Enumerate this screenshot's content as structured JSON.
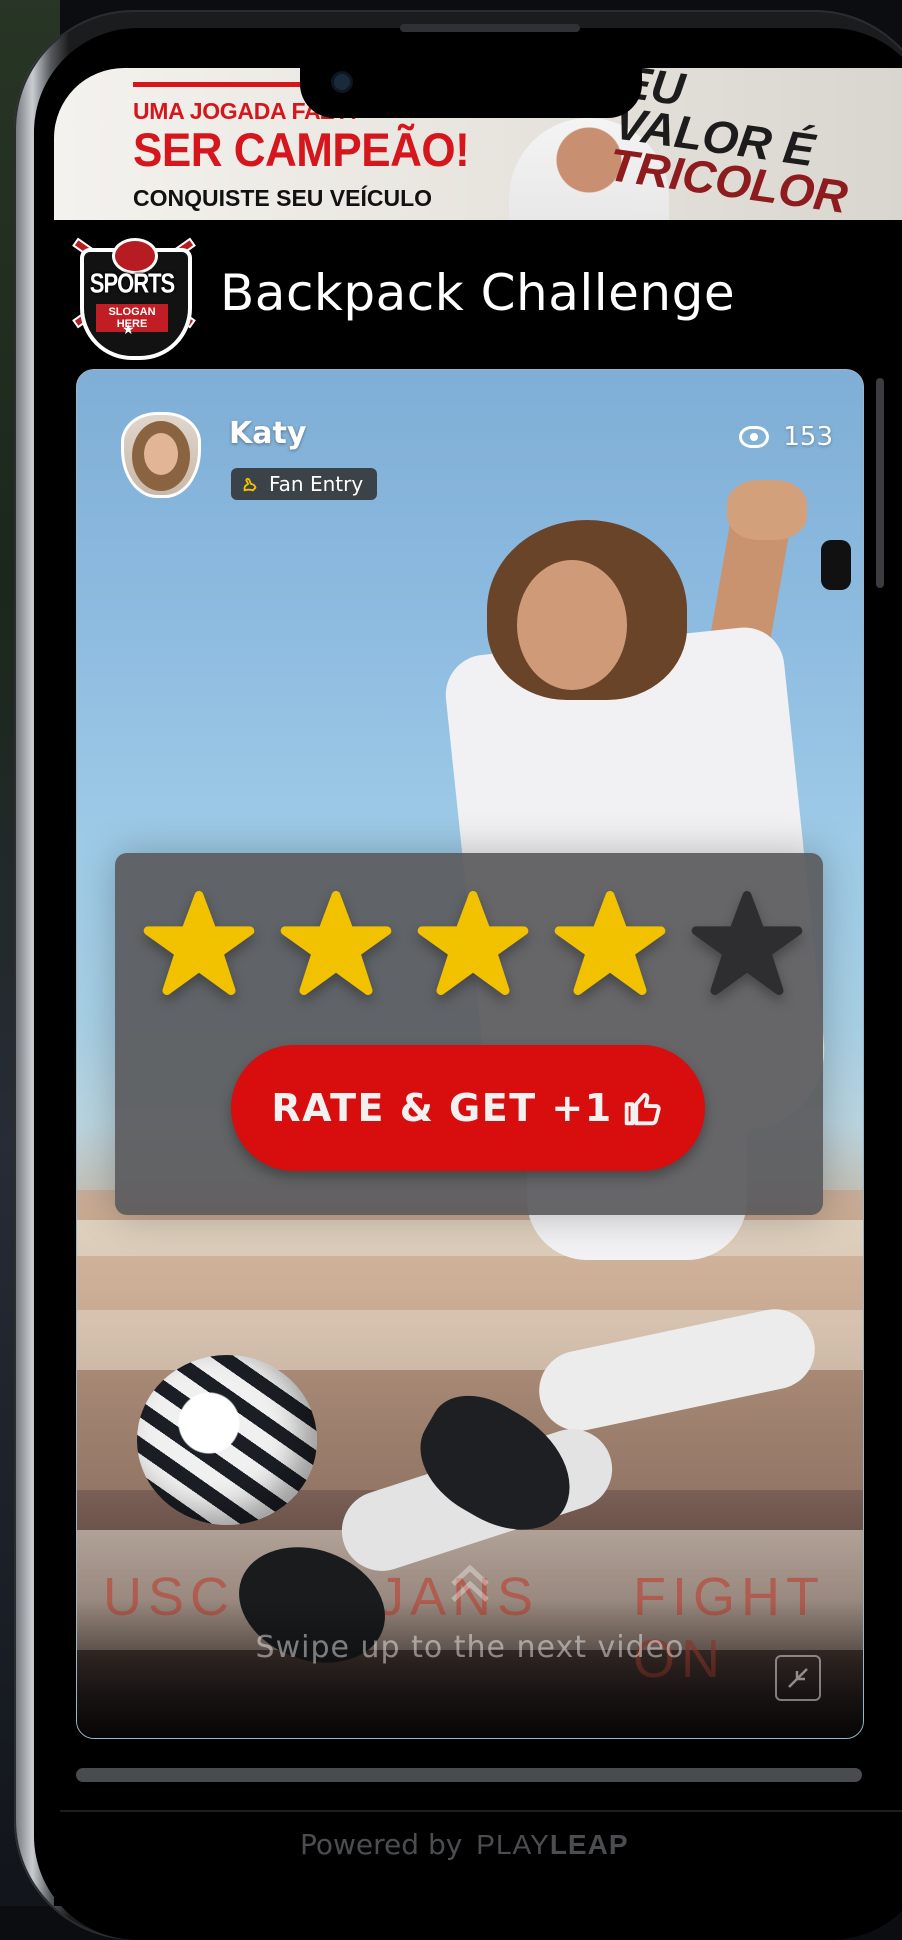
{
  "banner": {
    "line1": "UMA JOGADA FAZ A",
    "line2": "SER CAMPEÃO!",
    "line3": "CONQUISTE SEU VEÍCULO",
    "slogan_a": "EU",
    "slogan_b": "VALOR É",
    "slogan_c": "TRICOLOR"
  },
  "header": {
    "logo_text": "SPORTS LOGO",
    "logo_slogan": "SLOGAN HERE",
    "title": "Backpack Challenge"
  },
  "entry": {
    "user_name": "Katy",
    "badge_label": "Fan Entry",
    "views": "153"
  },
  "background_text": {
    "left": "USC",
    "middle": "JANS",
    "right": "FIGHT ON"
  },
  "rating": {
    "value": 4,
    "max": 5,
    "button_label": "RATE & GET +1",
    "star_color": "#f2c200",
    "empty_star_color": "#2e2e30"
  },
  "swipe": {
    "text": "Swipe up to the next video"
  },
  "footer": {
    "powered_by": "Powered by",
    "brand_light": "PLAY",
    "brand_bold": "LEAP"
  },
  "colors": {
    "accent": "#d80d0d",
    "background": "#000000"
  }
}
